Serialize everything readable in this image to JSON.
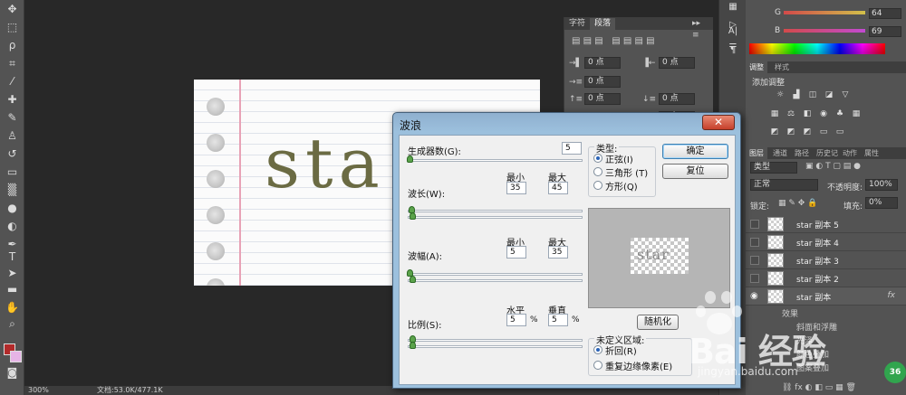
{
  "toolbar": {
    "tools": [
      "move-tool",
      "marquee-tool",
      "lasso-tool",
      "quick-select-tool",
      "crop-tool",
      "eyedropper-tool",
      "healing-tool",
      "brush-tool",
      "clone-stamp-tool",
      "history-brush-tool",
      "eraser-tool",
      "gradient-tool",
      "blur-tool",
      "dodge-tool",
      "pen-tool",
      "type-tool",
      "path-select-tool",
      "shape-tool",
      "hand-tool",
      "zoom-tool"
    ],
    "foreground_color": "#b22a2a",
    "background_color": "#e6b4e6"
  },
  "document": {
    "art_text": "sta"
  },
  "statusbar": {
    "zoom": "300%",
    "doc_info": "文档:53.0K/477.1K"
  },
  "para_panel": {
    "tabs": [
      "字符",
      "段落"
    ],
    "active_tab": "段落",
    "indent_left": "0 点",
    "indent_right": "0 点",
    "indent_first": "0 点",
    "space_before": "0 点",
    "space_after": "0 点",
    "space_extra": "0 点"
  },
  "right_panel": {
    "g_label": "G",
    "g_value": "64",
    "b_label": "B",
    "b_value": "69",
    "adjust_tabs": [
      "调整",
      "样式"
    ],
    "adjust_title": "添加调整",
    "layer_tabs": [
      "图层",
      "通道",
      "路径",
      "历史记",
      "动作",
      "属性"
    ],
    "kind_filter": "类型",
    "blend_mode": "正常",
    "opacity_label": "不透明度:",
    "opacity_value": "100%",
    "lock_label": "锁定:",
    "fill_label": "填充:",
    "fill_value": "0%",
    "layers": [
      {
        "name": "star 副本 5"
      },
      {
        "name": "star 副本 4"
      },
      {
        "name": "star 副本 3"
      },
      {
        "name": "star 副本 2"
      },
      {
        "name": "star 副本"
      }
    ],
    "layer_fx": "fx",
    "effects_label": "效果",
    "effect_items": [
      "斜面和浮雕",
      "光泽",
      "颜色叠加",
      "图案叠加"
    ]
  },
  "wave_dialog": {
    "title": "波浪",
    "close_label": "✕",
    "generators_label": "生成器数(G):",
    "generators_value": "5",
    "min_label": "最小",
    "max_label": "最大",
    "wavelength_label": "波长(W):",
    "wavelength_min": "35",
    "wavelength_max": "45",
    "amplitude_label": "波幅(A):",
    "amplitude_min": "5",
    "amplitude_max": "35",
    "scale_label": "比例(S):",
    "horizontal_label": "水平",
    "vertical_label": "垂直",
    "scale_h": "5",
    "scale_v": "5",
    "unit_percent": "%",
    "type_title": "类型:",
    "type_sine": "正弦(I)",
    "type_triangle": "三角形 (T)",
    "type_square": "方形(Q)",
    "ok_label": "确定",
    "reset_label": "复位",
    "preview_text": "star",
    "randomize_label": "随机化",
    "undefined_area_title": "未定义区域:",
    "wrap_around": "折回(R)",
    "repeat_edge": "重复边缘像素(E)"
  },
  "watermark": {
    "brand": "Bai 经验",
    "url": "jingyan.baidu.com",
    "badge": "36"
  }
}
